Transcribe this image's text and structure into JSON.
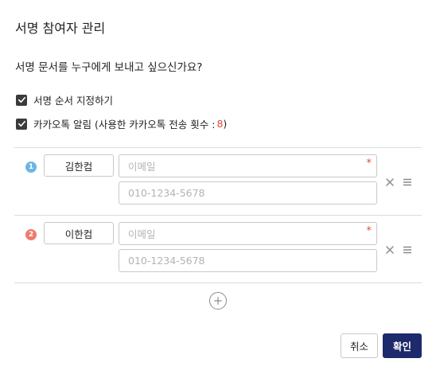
{
  "dialog": {
    "title": "서명 참여자 관리",
    "question": "서명 문서를 누구에게 보내고 싶으신가요?"
  },
  "options": {
    "signing_order": {
      "label": "서명 순서 지정하기",
      "checked": true
    },
    "kakao": {
      "label": "카카오톡 알림 (사용한 카카오톡 전송 횟수 : ",
      "count": "8",
      "suffix": ")",
      "checked": true
    }
  },
  "participants": [
    {
      "number": "1",
      "badge_color": "#6cb6e4",
      "name": "김한컴",
      "email_placeholder": "이메일",
      "phone_placeholder": "010-1234-5678",
      "required_mark": "*"
    },
    {
      "number": "2",
      "badge_color": "#ef7a6c",
      "name": "이한컴",
      "email_placeholder": "이메일",
      "phone_placeholder": "010-1234-5678",
      "required_mark": "*"
    }
  ],
  "icons": {
    "remove": "close-icon",
    "reorder": "drag-handle-icon",
    "add": "plus-circle-icon",
    "checkbox": "check-icon"
  },
  "buttons": {
    "cancel": "취소",
    "confirm": "확인"
  },
  "colors": {
    "accent": "#1d2a6b",
    "required": "#e04a3a",
    "count": "#e04a3a"
  }
}
